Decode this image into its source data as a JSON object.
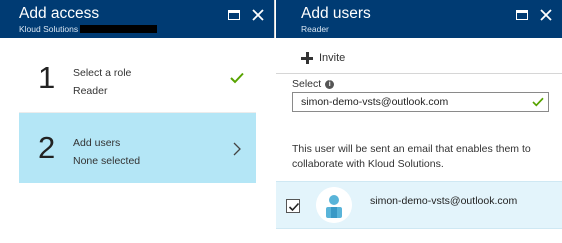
{
  "left_blade": {
    "title": "Add access",
    "subtitle": "Kloud Solutions",
    "steps": [
      {
        "number": "1",
        "label": "Select a role",
        "value": "Reader"
      },
      {
        "number": "2",
        "label": "Add users",
        "value": "None selected"
      }
    ]
  },
  "right_blade": {
    "title": "Add users",
    "subtitle": "Reader",
    "invite_label": "Invite",
    "select_label": "Select",
    "select_value": "simon-demo-vsts@outlook.com",
    "description": "This user will be sent an email that enables them to collaborate with Kloud Solutions.",
    "result": {
      "email": "simon-demo-vsts@outlook.com",
      "checked": true
    }
  },
  "colors": {
    "header_bg": "#003b73",
    "selected_step_bg": "#b4e6f6",
    "result_row_bg": "#e3f4fb",
    "check_green": "#57a300"
  },
  "icons": [
    "maximize-icon",
    "close-icon",
    "check-icon",
    "chevron-right-icon",
    "plus-icon",
    "info-icon",
    "checkbox-check-icon",
    "user-avatar-icon"
  ]
}
